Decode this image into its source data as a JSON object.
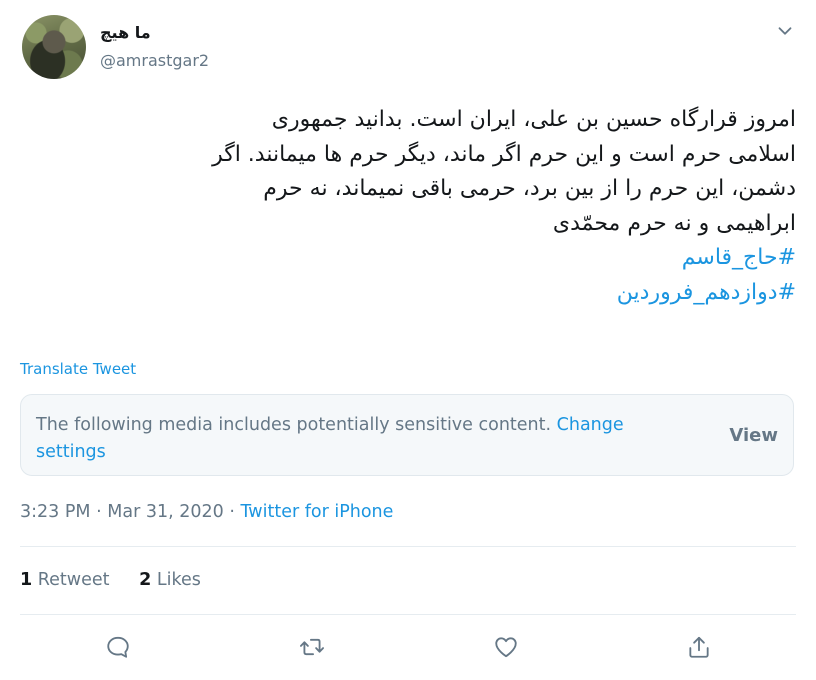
{
  "author": {
    "display_name": "ما هیچ",
    "handle": "@amrastgar2"
  },
  "tweet": {
    "lines": [
      "امروز قرارگاه حسین بن علی، ایران است. بدانید جمهوری",
      "اسلامی حرم است و این حرم اگر ماند، دیگر حرم ها میمانند. اگر",
      "دشمن، این حرم را از بین برد، حرمی باقی نمیماند، نه حرم",
      "ابراهیمی و نه حرم محمّدی"
    ],
    "hashtags": [
      "#حاج_قاسم",
      "#دوازدهم_فروردین"
    ]
  },
  "translate_label": "Translate Tweet",
  "sensitive": {
    "message": "The following media includes potentially sensitive content.",
    "change_settings": "Change settings",
    "view_label": "View"
  },
  "meta": {
    "time": "3:23 PM",
    "separator": "·",
    "date": "Mar 31, 2020",
    "source": "Twitter for iPhone"
  },
  "stats": {
    "retweet_count": "1",
    "retweet_label": "Retweet",
    "like_count": "2",
    "like_label": "Likes"
  },
  "actions": [
    "reply-icon",
    "retweet-icon",
    "like-icon",
    "share-icon"
  ],
  "colors": {
    "link": "#1b95e0",
    "secondary_text": "#657786",
    "primary_text": "#14171a",
    "border": "#e6ecf0"
  }
}
